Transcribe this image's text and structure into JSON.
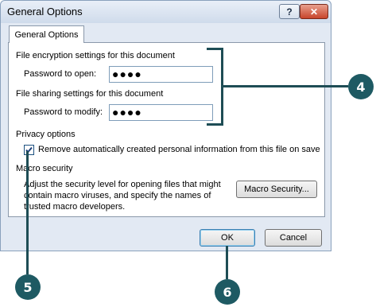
{
  "window": {
    "title": "General Options",
    "help_glyph": "?",
    "close_glyph": "✕"
  },
  "tab": {
    "label": "General Options"
  },
  "encryption": {
    "heading": "File encryption settings for this document",
    "label": "Password to open:",
    "value": "●●●●"
  },
  "sharing": {
    "heading": "File sharing settings for this document",
    "label": "Password to modify:",
    "value": "●●●●"
  },
  "privacy": {
    "heading": "Privacy options",
    "checkbox_label": "Remove automatically created personal information from this file on save",
    "checked": true
  },
  "macro": {
    "heading": "Macro security",
    "description_line1": "Adjust the security level for opening files that might",
    "description_line2": "contain macro viruses, and specify the names of",
    "description_line3": "trusted macro developers.",
    "button_label": "Macro Security..."
  },
  "footer": {
    "ok_label": "OK",
    "cancel_label": "Cancel"
  },
  "callouts": {
    "badge_4": "4",
    "badge_5": "5",
    "badge_6": "6",
    "color": "#1e5a63"
  }
}
